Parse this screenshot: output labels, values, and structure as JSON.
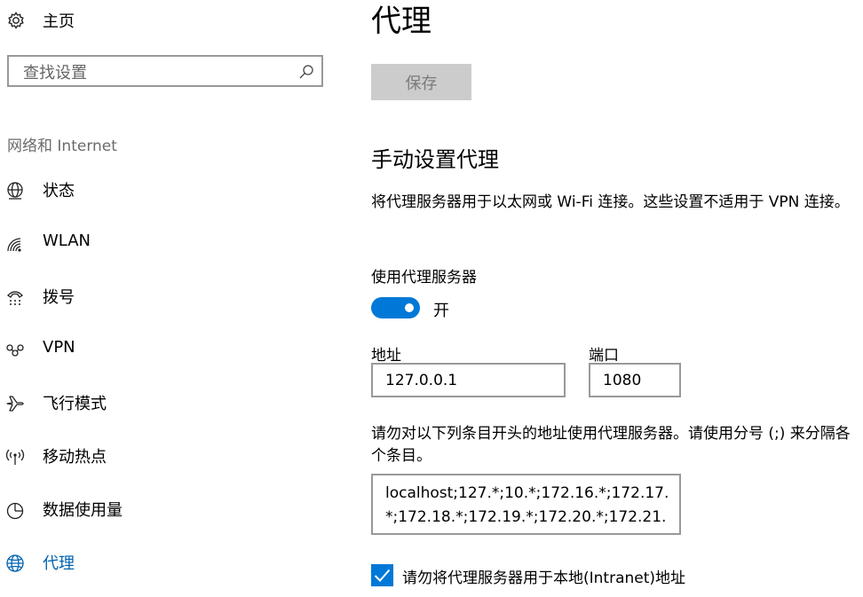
{
  "sidebar": {
    "home_label": "主页",
    "search_placeholder": "查找设置",
    "section_title": "网络和 Internet",
    "items": [
      {
        "label": "状态",
        "icon": "globe-monitor-icon"
      },
      {
        "label": "WLAN",
        "icon": "wifi-icon"
      },
      {
        "label": "拨号",
        "icon": "dialup-icon"
      },
      {
        "label": "VPN",
        "icon": "vpn-icon"
      },
      {
        "label": "飞行模式",
        "icon": "airplane-icon"
      },
      {
        "label": "移动热点",
        "icon": "hotspot-icon"
      },
      {
        "label": "数据使用量",
        "icon": "data-usage-icon"
      },
      {
        "label": "代理",
        "icon": "globe-icon",
        "active": true
      }
    ]
  },
  "main": {
    "title": "代理",
    "save_label": "保存",
    "section_title": "手动设置代理",
    "description": "将代理服务器用于以太网或 Wi-Fi 连接。这些设置不适用于 VPN 连接。",
    "use_proxy_label": "使用代理服务器",
    "toggle_state": "开",
    "address_label": "地址",
    "address_value": "127.0.0.1",
    "port_label": "端口",
    "port_value": "1080",
    "exceptions_note": "请勿对以下列条目开头的地址使用代理服务器。请使用分号 (;) 来分隔各个条目。",
    "exceptions_value": "localhost;127.*;10.*;172.16.*;172.17.\n*;172.18.*;172.19.*;172.20.*;172.21.",
    "bypass_local_label": "请勿将代理服务器用于本地(Intranet)地址",
    "bypass_local_checked": true
  },
  "colors": {
    "accent": "#0078d7",
    "active_text": "#0063b1",
    "disabled_button": "#cccccc"
  }
}
